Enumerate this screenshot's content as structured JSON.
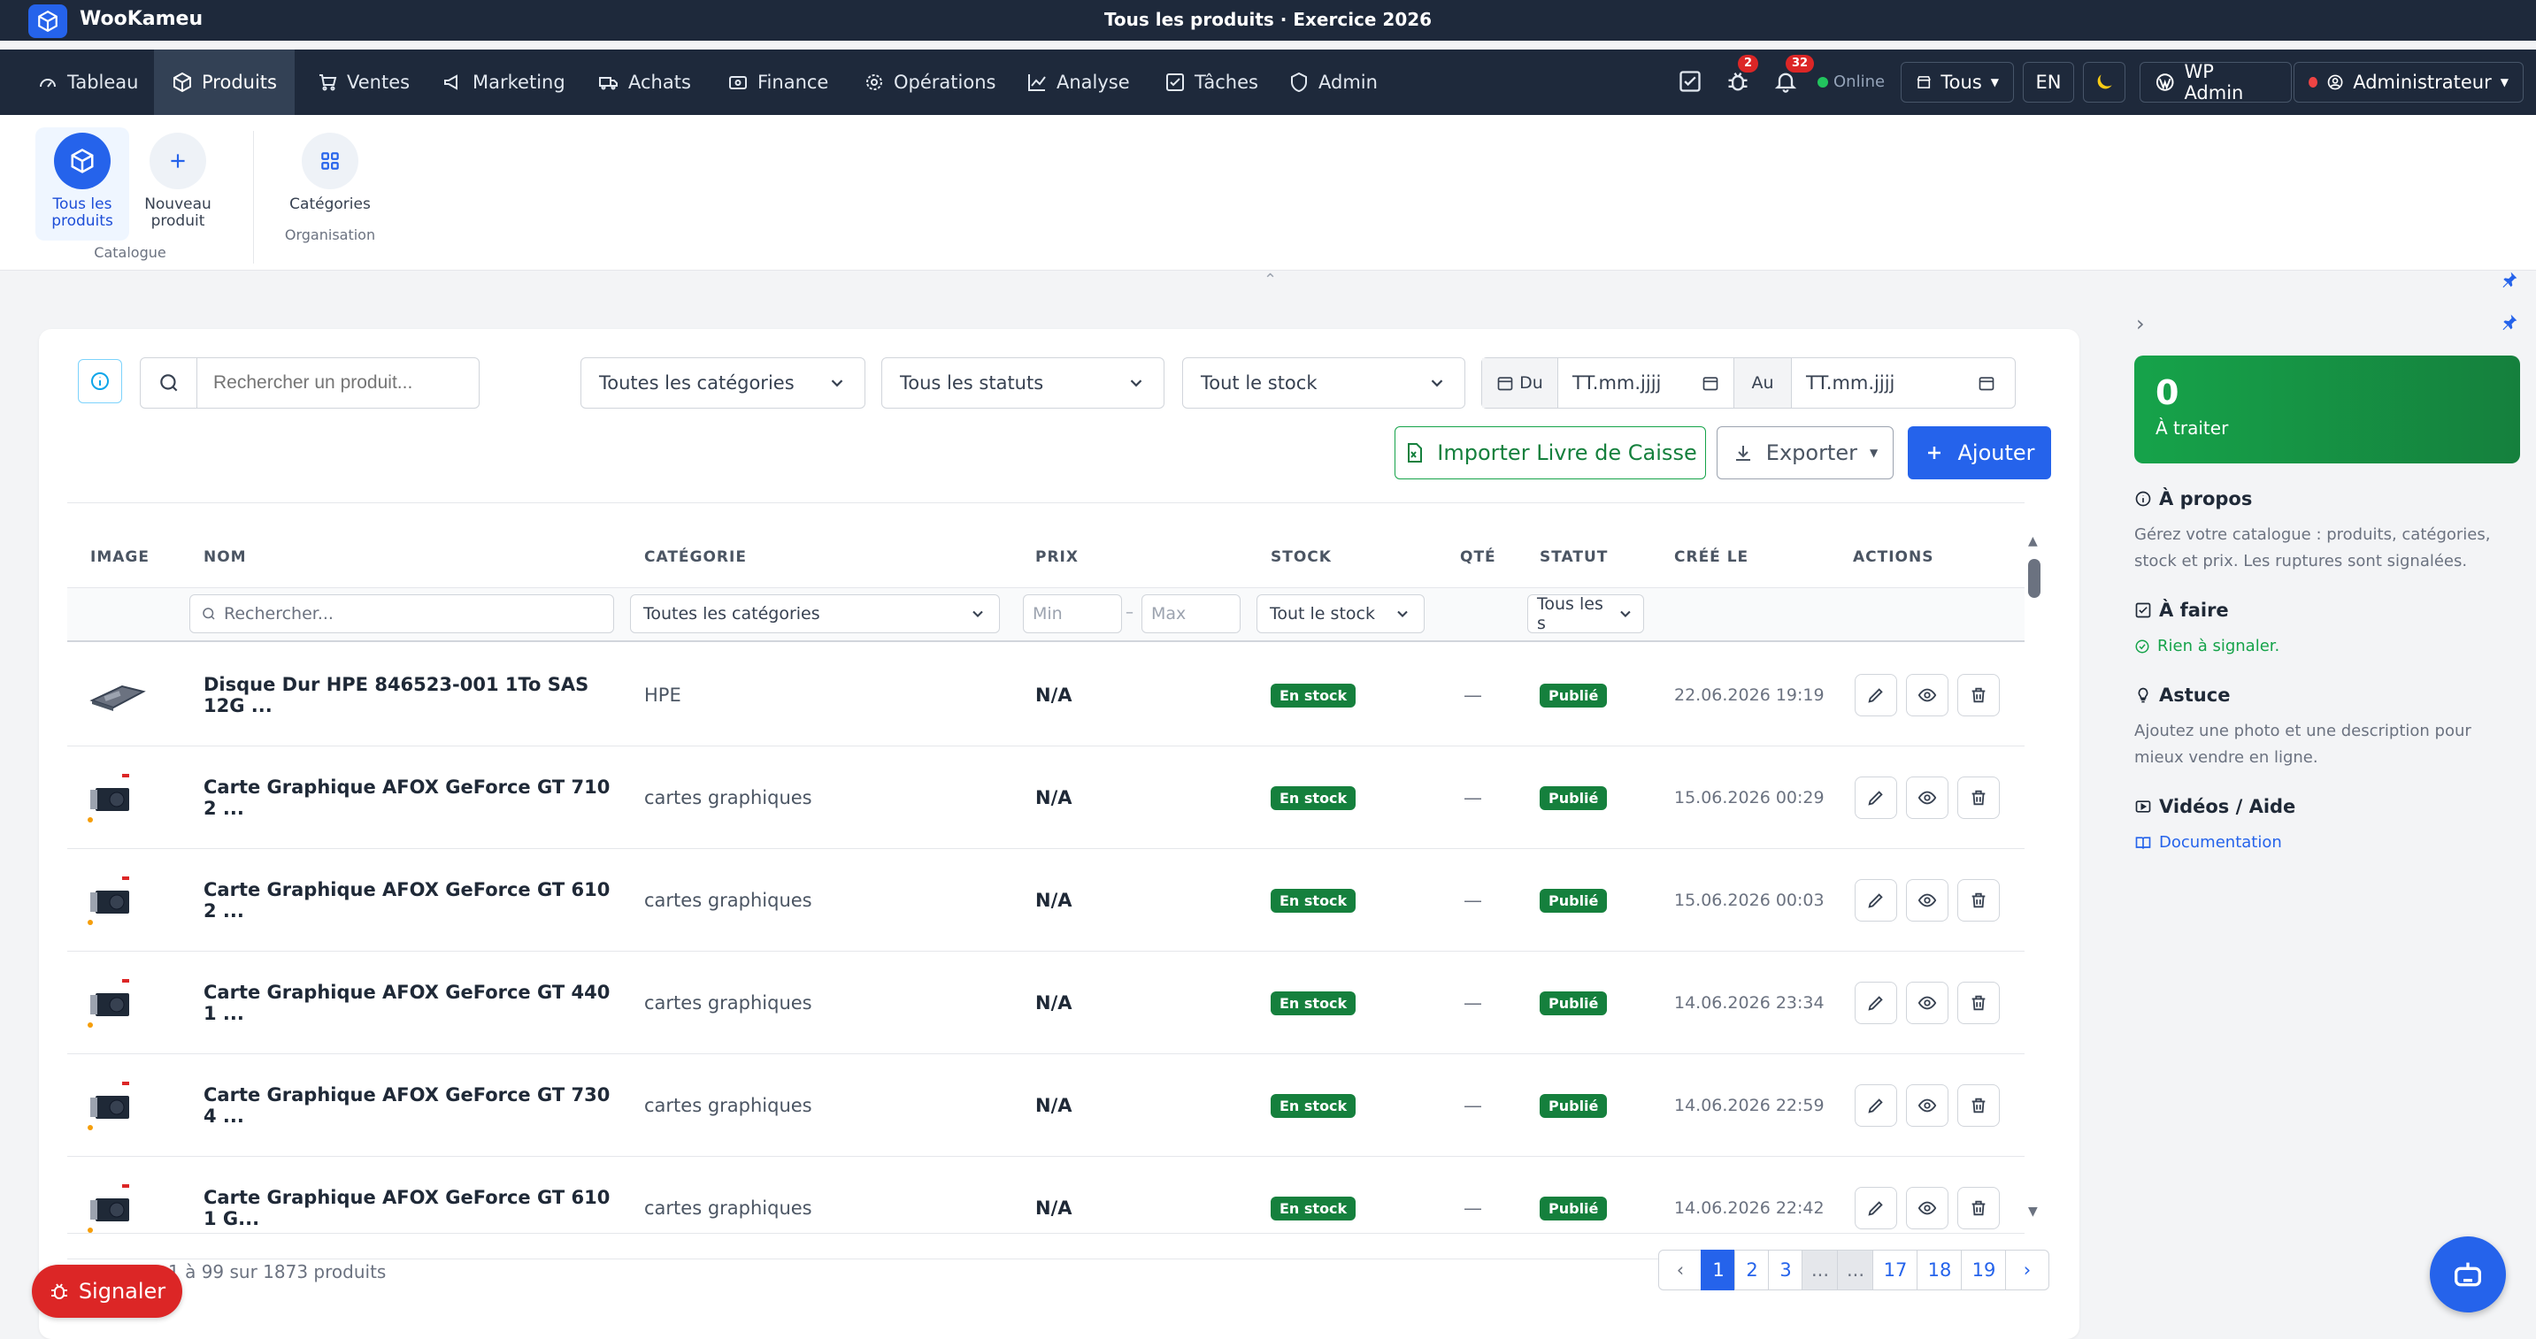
{
  "app": {
    "name": "WooKameu",
    "title": "Tous les produits · Exercice 2026"
  },
  "nav": {
    "items": [
      {
        "label": "Tableau",
        "icon": "gauge-icon"
      },
      {
        "label": "Produits",
        "icon": "box-icon"
      },
      {
        "label": "Ventes",
        "icon": "cart-icon"
      },
      {
        "label": "Marketing",
        "icon": "megaphone-icon"
      },
      {
        "label": "Achats",
        "icon": "truck-icon"
      },
      {
        "label": "Finance",
        "icon": "wallet-icon"
      },
      {
        "label": "Opérations",
        "icon": "gear-icon"
      },
      {
        "label": "Analyse",
        "icon": "chart-line-icon"
      },
      {
        "label": "Tâches",
        "icon": "checkbox-icon"
      },
      {
        "label": "Admin",
        "icon": "shield-icon"
      }
    ],
    "bug_count": "2",
    "notif_count": "32",
    "status": "Online",
    "store_label": "Tous",
    "lang": "EN",
    "wp_admin": "WP Admin",
    "user": "Administrateur"
  },
  "subnav": {
    "all_products_1": "Tous les",
    "all_products_2": "produits",
    "new_product_1": "Nouveau",
    "new_product_2": "produit",
    "categories": "Catégories",
    "group_catalogue": "Catalogue",
    "group_organisation": "Organisation"
  },
  "filters": {
    "search_placeholder": "Rechercher un produit...",
    "category": "Toutes les catégories",
    "status": "Tous les statuts",
    "stock": "Tout le stock",
    "from_label": "Du",
    "to_label": "Au",
    "date_placeholder": "TT.mm.jjjj"
  },
  "actions": {
    "import": "Importer Livre de Caisse",
    "export": "Exporter",
    "add": "Ajouter"
  },
  "table": {
    "headers": [
      "IMAGE",
      "NOM",
      "CATÉGORIE",
      "PRIX",
      "STOCK",
      "QTÉ",
      "STATUT",
      "CRÉÉ LE",
      "ACTIONS"
    ],
    "filter_name": "Rechercher...",
    "filter_category": "Toutes les catégories",
    "filter_min": "Min",
    "filter_max": "Max",
    "filter_stock": "Tout le stock",
    "filter_status": "Tous les s",
    "rows": [
      {
        "name": "Disque Dur HPE 846523-001 1To SAS 12G ...",
        "category": "HPE",
        "price": "N/A",
        "stock": "En stock",
        "qty": "—",
        "status": "Publié",
        "created": "22.06.2026 19:19"
      },
      {
        "name": "Carte Graphique AFOX GeForce GT 710 2 ...",
        "category": "cartes graphiques",
        "price": "N/A",
        "stock": "En stock",
        "qty": "—",
        "status": "Publié",
        "created": "15.06.2026 00:29"
      },
      {
        "name": "Carte Graphique AFOX GeForce GT 610 2 ...",
        "category": "cartes graphiques",
        "price": "N/A",
        "stock": "En stock",
        "qty": "—",
        "status": "Publié",
        "created": "15.06.2026 00:03"
      },
      {
        "name": "Carte Graphique AFOX GeForce GT 440 1 ...",
        "category": "cartes graphiques",
        "price": "N/A",
        "stock": "En stock",
        "qty": "—",
        "status": "Publié",
        "created": "14.06.2026 23:34"
      },
      {
        "name": "Carte Graphique AFOX GeForce GT 730 4 ...",
        "category": "cartes graphiques",
        "price": "N/A",
        "stock": "En stock",
        "qty": "—",
        "status": "Publié",
        "created": "14.06.2026 22:59"
      },
      {
        "name": "Carte Graphique AFOX GeForce GT 610 1 G...",
        "category": "cartes graphiques",
        "price": "N/A",
        "stock": "En stock",
        "qty": "—",
        "status": "Publié",
        "created": "14.06.2026 22:42"
      }
    ]
  },
  "footer": {
    "summary": "1 à 99 sur 1873 produits",
    "pages": [
      "1",
      "2",
      "3",
      "...",
      "...",
      "17",
      "18",
      "19"
    ],
    "report": "Signaler"
  },
  "side": {
    "count": "0",
    "count_label": "À traiter",
    "about_title": "À propos",
    "about_text": "Gérez votre catalogue : produits, catégories, stock et prix. Les ruptures sont signalées.",
    "todo_title": "À faire",
    "todo_text": "Rien à signaler.",
    "tip_title": "Astuce",
    "tip_text": "Ajoutez une photo et une description pour mieux vendre en ligne.",
    "videos_title": "Vidéos / Aide",
    "doc_link": "Documentation"
  },
  "colors": {
    "primary": "#2563eb",
    "nav_bg": "#1e293b",
    "success": "#15803d",
    "danger": "#dc2626"
  }
}
